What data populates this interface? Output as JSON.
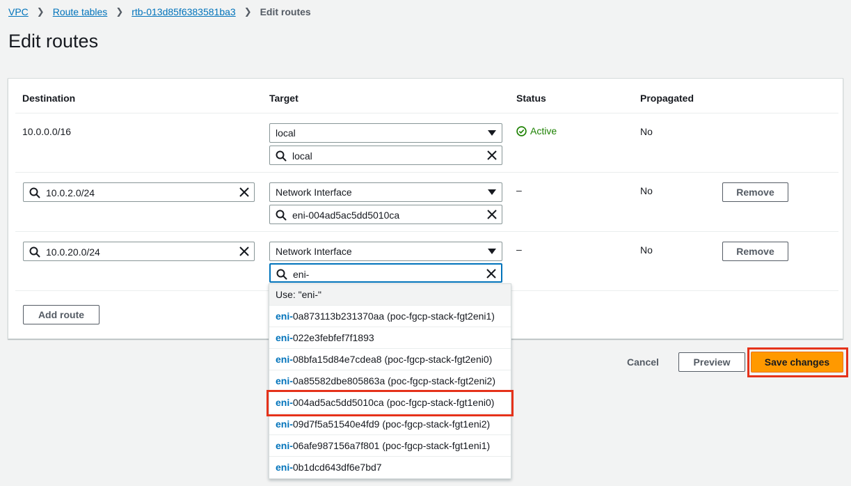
{
  "breadcrumb": {
    "vpc": "VPC",
    "route_tables": "Route tables",
    "rtb": "rtb-013d85f6383581ba3",
    "current": "Edit routes"
  },
  "page_title": "Edit routes",
  "table": {
    "headers": {
      "destination": "Destination",
      "target": "Target",
      "status": "Status",
      "propagated": "Propagated"
    },
    "rows": [
      {
        "destination": "10.0.0.0/16",
        "target_type": "local",
        "target_search": "local",
        "status": "Active",
        "propagated": "No"
      },
      {
        "destination": "10.0.2.0/24",
        "target_type": "Network Interface",
        "target_search": "eni-004ad5ac5dd5010ca",
        "status": "–",
        "propagated": "No",
        "remove_label": "Remove"
      },
      {
        "destination": "10.0.20.0/24",
        "target_type": "Network Interface",
        "target_search": "eni-",
        "status": "–",
        "propagated": "No",
        "remove_label": "Remove"
      }
    ],
    "add_route_label": "Add route"
  },
  "dropdown": {
    "use_option": "Use: \"eni-\"",
    "match_prefix": "eni-",
    "options": [
      {
        "rest": "0a873113b231370aa (poc-fgcp-stack-fgt2eni1)"
      },
      {
        "rest": "022e3febfef7f1893"
      },
      {
        "rest": "08bfa15d84e7cdea8 (poc-fgcp-stack-fgt2eni0)"
      },
      {
        "rest": "0a85582dbe805863a (poc-fgcp-stack-fgt2eni2)"
      },
      {
        "rest": "004ad5ac5dd5010ca (poc-fgcp-stack-fgt1eni0)"
      },
      {
        "rest": "09d7f5a51540e4fd9 (poc-fgcp-stack-fgt1eni2)"
      },
      {
        "rest": "06afe987156a7f801 (poc-fgcp-stack-fgt1eni1)"
      },
      {
        "rest": "0b1dcd643df6e7bd7"
      }
    ]
  },
  "footer": {
    "cancel_label": "Cancel",
    "preview_label": "Preview",
    "save_label": "Save changes"
  },
  "colors": {
    "accent": "#ec7211",
    "link": "#0073bb",
    "success": "#1d8102",
    "annotation": "#e5321a"
  },
  "icons": [
    "chevron-right-icon",
    "search-icon",
    "clear-icon",
    "caret-down-icon",
    "check-circle-icon"
  ]
}
